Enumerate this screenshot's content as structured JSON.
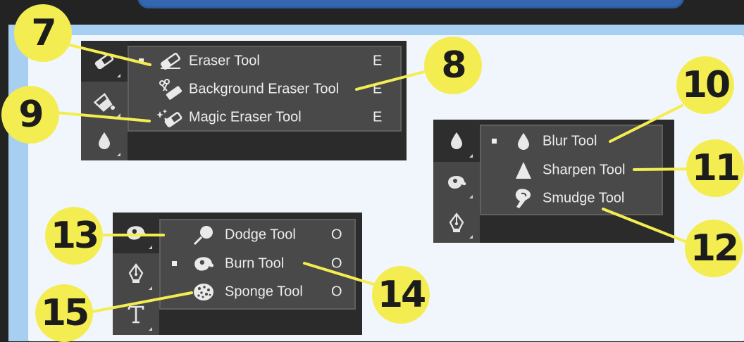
{
  "colors": {
    "callout": "#f4ed51",
    "frame": "#a7cff1",
    "canvas": "#f1f6fc",
    "panel_dark": "#2b2b2b",
    "menu_bg": "#494949",
    "text": "#ededed",
    "header_bar": "#3466b1"
  },
  "callouts": [
    "7",
    "8",
    "9",
    "10",
    "11",
    "12",
    "13",
    "14",
    "15"
  ],
  "eraser_panel": {
    "toolbar_icons": [
      "eraser-icon",
      "paint-bucket-icon",
      "blur-drop-icon"
    ],
    "items": [
      {
        "label": "Eraser Tool",
        "shortcut": "E",
        "icon": "eraser-icon",
        "selected": true
      },
      {
        "label": "Background Eraser Tool",
        "shortcut": "E",
        "icon": "background-eraser-icon",
        "selected": false
      },
      {
        "label": "Magic Eraser Tool",
        "shortcut": "E",
        "icon": "magic-eraser-icon",
        "selected": false
      }
    ]
  },
  "blur_panel": {
    "toolbar_icons": [
      "blur-drop-icon",
      "burn-hand-icon",
      "pen-icon"
    ],
    "items": [
      {
        "label": "Blur Tool",
        "icon": "blur-drop-icon",
        "selected": true
      },
      {
        "label": "Sharpen Tool",
        "icon": "sharpen-triangle-icon",
        "selected": false
      },
      {
        "label": "Smudge Tool",
        "icon": "smudge-finger-icon",
        "selected": false
      }
    ]
  },
  "dodge_panel": {
    "toolbar_icons": [
      "burn-hand-icon",
      "pen-icon",
      "type-icon"
    ],
    "items": [
      {
        "label": "Dodge Tool",
        "shortcut": "O",
        "icon": "dodge-lollipop-icon",
        "selected": false
      },
      {
        "label": "Burn Tool",
        "shortcut": "O",
        "icon": "burn-hand-icon",
        "selected": true
      },
      {
        "label": "Sponge Tool",
        "shortcut": "O",
        "icon": "sponge-icon",
        "selected": false
      }
    ]
  }
}
